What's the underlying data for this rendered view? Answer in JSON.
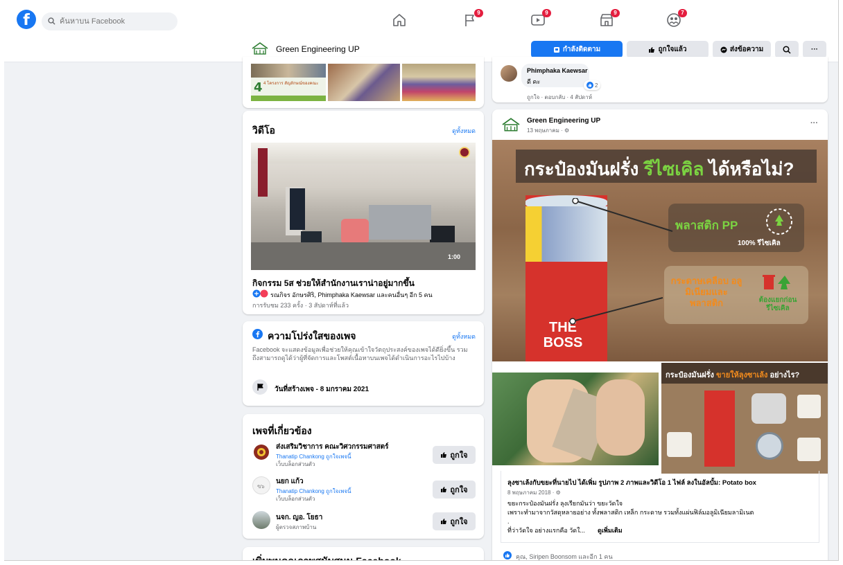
{
  "nav": {
    "search_placeholder": "ค้นหาบน Facebook",
    "badges": {
      "pages": "9",
      "watch": "9",
      "marketplace": "9",
      "groups": "7"
    }
  },
  "page": {
    "name": "Green Engineering UP",
    "follow_label": "กำลังติดตาม",
    "liked_label": "ถูกใจแล้ว",
    "message_label": "ส่งข้อความ",
    "more_label": "···"
  },
  "photos_card": {
    "thumb1_caption": "4 โครงการ สัญลักษณ์ของคณะ"
  },
  "video_card": {
    "title": "วิดีโอ",
    "see_all": "ดูทั้งหมด",
    "duration": "1:00",
    "video_title": "กิจกรรม 5ส ช่วยให้สำนักงานเราน่าอยู่มากขึ้น",
    "reactors": "รณกิจร อักษรศิริ, Phimphaka Kaewsar และคนอื่นๆ อีก 5 คน",
    "meta": "การรับชม 233 ครั้ง · 3 สัปดาห์ที่แล้ว"
  },
  "transparency_card": {
    "title": "ความโปร่งใสของเพจ",
    "see_all": "ดูทั้งหมด",
    "description": "Facebook จะแสดงข้อมูลเพื่อช่วยให้คุณเข้าใจวัตถุประสงค์ของเพจได้ดียิ่งขึ้น รวมถึงสามารถดูได้ว่าผู้ที่จัดการและโพสต์เนื้อหาบนเพจได้ดำเนินการอะไรไปบ้าง",
    "created": "วันที่สร้างเพจ - 8 มกราคม 2021"
  },
  "related_card": {
    "title": "เพจที่เกี่ยวข้อง",
    "items": [
      {
        "name": "ส่งเสริมวิชาการ คณะวิศวกรรมศาสตร์",
        "sub": "Thanatip Chankong ถูกใจเพจนี้",
        "sub2": "เว็บบล็อกส่วนตัว",
        "like": "ถูกใจ"
      },
      {
        "name": "นยก แก้ว",
        "sub": "Thanatip Chankong ถูกใจเพจนี้",
        "sub2": "เว็บบล็อกส่วนตัว",
        "like": "ถูกใจ"
      },
      {
        "name": "นจก. ญอ. โยธา",
        "sub": "",
        "sub2": "ผู้ตรวจสภาพบ้าน",
        "like": "ถูกใจ"
      }
    ]
  },
  "next_card": {
    "title": "เพิ่มพูนคุณภาพสนับสนุน Facebook"
  },
  "comment": {
    "author": "Phimphaka Kaewsar",
    "text": "ดี คะ",
    "reaction_count": "2",
    "actions": "ถูกใจ · ตอบกลับ · 4 สัปดาห์"
  },
  "post": {
    "author": "Green Engineering UP",
    "date": "13 พฤษภาคม · ⚙",
    "more": "···",
    "banner": {
      "headline_a": "กระป๋องมันฝรั่ง ",
      "headline_b": "รีไซเคิล",
      "headline_c": " ได้หรือไม่?",
      "label_pp": "พลาสติก PP",
      "label_pp_sub": "100% รีไซเคิล",
      "label_foil": "กระดาษเคลือบ อลูมิเนียมและ พลาสติก",
      "label_foil_sub": "ต้องแยกก่อน รีไซเคิล",
      "can_text": "THE BOSS"
    },
    "inset_title_a": "กระป๋องมันฝรั่ง ",
    "inset_title_b": "ขายให้ลุงซาเล้ง",
    "inset_title_c": " อย่างไร?",
    "headline_text": "ลุงซาเล้งกับขยะที่นายไป ได้เพิ่ม รูปภาพ 2 ภาพและวิดีโอ 1 ไฟล์ ลงในอัลบั้ม: Potato box",
    "sub_date": "8 พฤษภาคม 2018 · ⚙",
    "body1": "ขยะกระป๋องมันฝรั่ง ลุงเรียกมันว่า ขยะวัดใจ",
    "body2": "เพราะทำมาจากวัสดุหลายอย่าง ทั้งพลาสติก เหล็ก กระดาษ รวมทั้งแผ่นฟิล์มอลูมิเนียมลามิเนต",
    "body3": ".",
    "body4": "ที่ว่าวัดใจ อย่างแรกคือ วัดใ...",
    "see_more": "ดูเพิ่มเติม",
    "footer": "คุณ, Siripen Boonsom และอีก 1 คน"
  },
  "colors": {
    "brand": "#1877f2",
    "badge": "#e41e3f",
    "green": "#42b72a"
  }
}
